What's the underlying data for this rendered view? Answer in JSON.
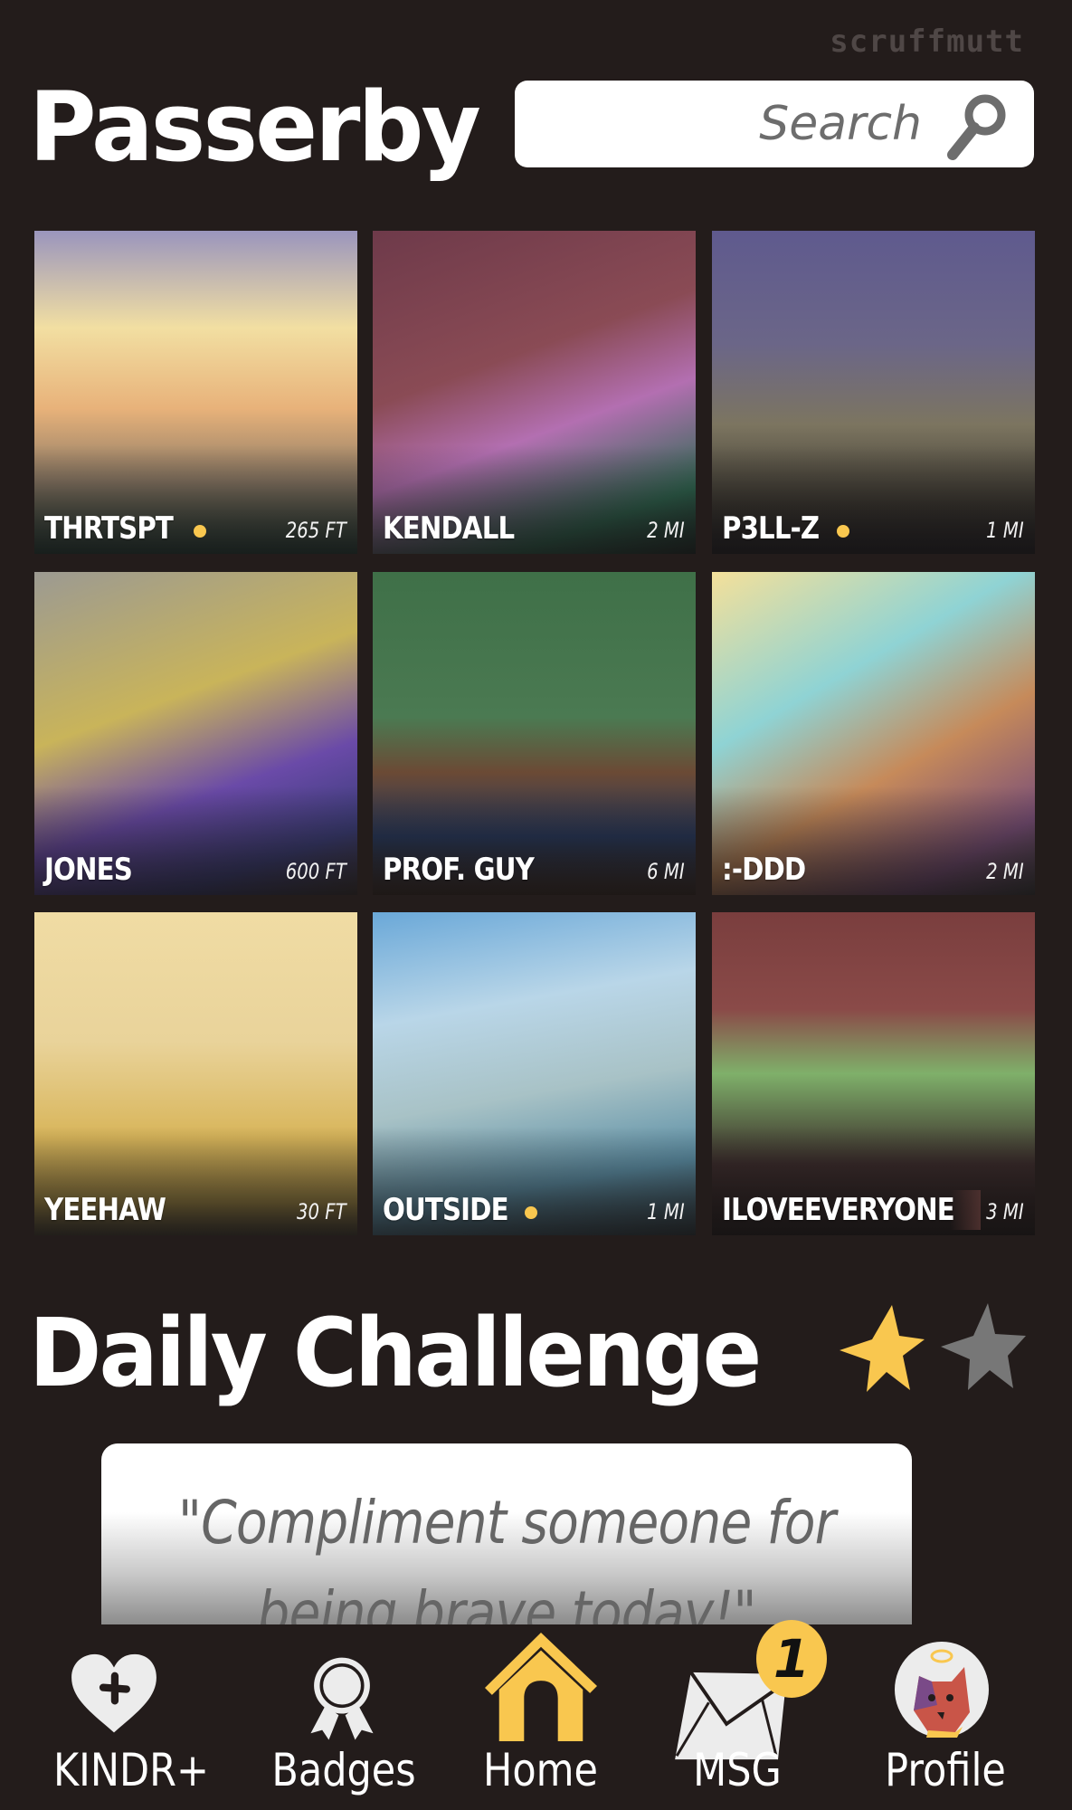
{
  "app": {
    "watermark": "scruffmutt"
  },
  "header": {
    "title": "Passerby",
    "search": {
      "placeholder": "Search",
      "value": ""
    }
  },
  "passersby": [
    {
      "name": "THRTSPT",
      "distance": "265 FT",
      "online": true,
      "art": "linear-gradient(to bottom, #9a95bd 0%, #f2dfa2 30%, #e8b27a 55%, #8b7a66 78%, #24433b 100%)"
    },
    {
      "name": "KENDALL",
      "distance": "2 MI",
      "online": false,
      "art": "linear-gradient(160deg, #6e3a4a 0%, #8a4b55 40%, #b36fb1 60%, #2f6b53 85%, #1d2b27 100%)"
    },
    {
      "name": "P3LL-Z",
      "distance": "1 MI",
      "online": true,
      "art": "linear-gradient(to bottom, #5f5a8e 0%, #6b6688 35%, #7c7560 60%, #3c3831 85%, #211f24 100%)"
    },
    {
      "name": "JONES",
      "distance": "600 FT",
      "online": false,
      "art": "linear-gradient(160deg, #9c9a92 0%, #c9b45a 40%, #6a4aa8 65%, #3b3d7a 85%, #3b3230 100%)"
    },
    {
      "name": "PROF. GUY",
      "distance": "6 MI",
      "online": false,
      "art": "linear-gradient(to bottom, #3f7048 0%, #4b7a52 45%, #6b4a35 62%, #26385d 82%, #3d2c24 100%)"
    },
    {
      "name": ":-DDD",
      "distance": "2 MI",
      "online": false,
      "art": "linear-gradient(150deg, #f4e09a 0%, #8fd3d4 35%, #c68a5a 60%, #7a4f78 85%, #3a3a3a 100%)"
    },
    {
      "name": "YEEHAW",
      "distance": "30 FT",
      "online": false,
      "art": "linear-gradient(to bottom, #f0dca4 0%, #e9d39a 40%, #d8b55a 70%, #9c8440 90%, #4a4434 100%)"
    },
    {
      "name": "OUTSIDE",
      "distance": "1 MI",
      "online": true,
      "art": "linear-gradient(170deg, #6aa8d8 0%, #b9d6e8 30%, #a8c2c6 55%, #5b8fa6 80%, #2e3a40 100%)"
    },
    {
      "name": "ILOVEEVERYONE",
      "distance": "3 MI",
      "online": false,
      "art": "linear-gradient(to bottom, #7a3e3e 0%, #8a4a48 30%, #7fb06a 50%, #3a2a2a 78%, #241c1c 100%)"
    }
  ],
  "daily_challenge": {
    "title": "Daily Challenge",
    "stars_earned": 1,
    "stars_total": 2,
    "prompt": "\"Compliment someone for being brave today!\"",
    "prompt_line1": "\"Compliment someone for",
    "prompt_line2": "being brave today!\""
  },
  "nav": {
    "items": [
      {
        "label": "KINDR+",
        "icon": "heart-plus-icon"
      },
      {
        "label": "Badges",
        "icon": "ribbon-badge-icon"
      },
      {
        "label": "Home",
        "icon": "doghouse-icon",
        "active": true
      },
      {
        "label": "MSG",
        "icon": "envelope-icon",
        "badge": "1"
      },
      {
        "label": "Profile",
        "icon": "avatar-icon"
      }
    ]
  },
  "colors": {
    "background": "#231c1b",
    "accent": "#f9c74f",
    "star_inactive": "#777777",
    "icon_light": "#ececec"
  }
}
